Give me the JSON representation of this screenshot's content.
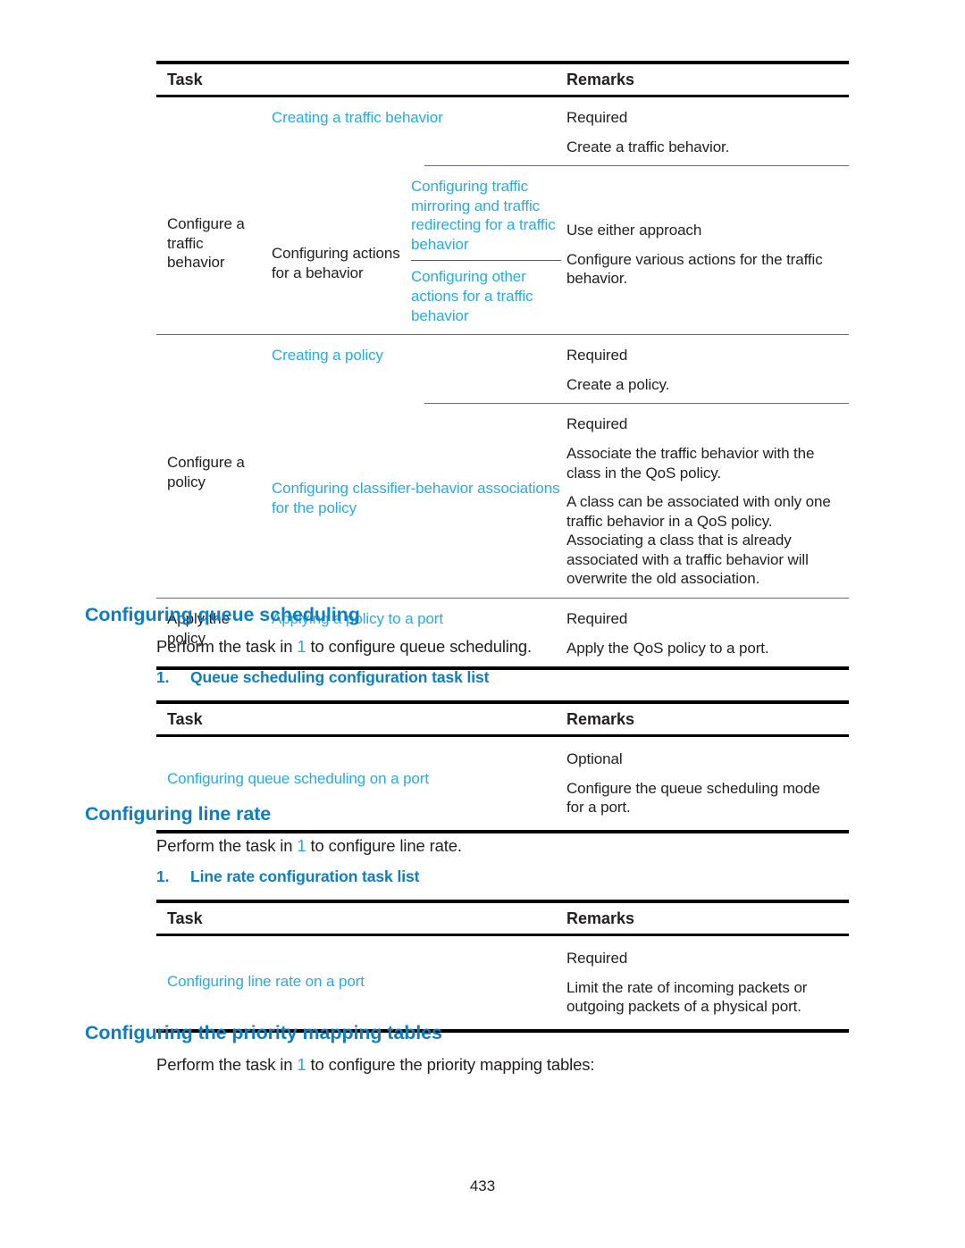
{
  "page": {
    "folio": "433"
  },
  "tables": {
    "main": {
      "headers": {
        "task": "Task",
        "remarks": "Remarks"
      },
      "rows": {
        "behavior_group_label": "Configure a traffic behavior",
        "creating_behavior_link": "Creating a traffic behavior",
        "creating_behavior_remark_1": "Required",
        "creating_behavior_remark_2": "Create a traffic behavior.",
        "configuring_actions_label": "Configuring actions for a behavior",
        "action_link_1": "Configuring traffic mirroring and traffic redirecting for a traffic behavior",
        "action_link_2": "Configuring other actions for a traffic behavior",
        "actions_remark_1": "Use either approach",
        "actions_remark_2": "Configure various actions for the traffic behavior.",
        "policy_group_label": "Configure a policy",
        "creating_policy_link": "Creating a policy",
        "creating_policy_remark_1": "Required",
        "creating_policy_remark_2": "Create a policy.",
        "classifier_link": "Configuring classifier-behavior associations for the policy",
        "classifier_remark_1": "Required",
        "classifier_remark_2": "Associate the traffic behavior with the class in the QoS policy.",
        "classifier_remark_3": "A class can be associated with only one traffic behavior in a QoS policy. Associating a class that is already associated with a traffic behavior will overwrite the old association.",
        "apply_group_label": "Apply the policy",
        "apply_link": "Applying a policy to a port",
        "apply_remark_1": "Required",
        "apply_remark_2": "Apply the QoS policy to a port."
      }
    },
    "queue": {
      "headers": {
        "task": "Task",
        "remarks": "Remarks"
      },
      "row": {
        "link": "Configuring queue scheduling on a port",
        "remark_1": "Optional",
        "remark_2": "Configure the queue scheduling mode for a port."
      }
    },
    "line_rate": {
      "headers": {
        "task": "Task",
        "remarks": "Remarks"
      },
      "row": {
        "link": "Configuring line rate on a port",
        "remark_1": "Required",
        "remark_2": "Limit the rate of incoming packets or outgoing packets of a physical port."
      }
    }
  },
  "sections": {
    "queue_scheduling": {
      "heading": "Configuring queue scheduling",
      "intro_before": "Perform the task in ",
      "intro_link": "1",
      "intro_after": " to configure queue scheduling.",
      "list_number": "1.",
      "list_label": "Queue scheduling configuration task list"
    },
    "line_rate": {
      "heading": "Configuring line rate",
      "intro_before": "Perform the task in ",
      "intro_link": "1",
      "intro_after": " to configure line rate.",
      "list_number": "1.",
      "list_label": "Line rate configuration task list"
    },
    "priority_mapping": {
      "heading": "Configuring the priority mapping tables",
      "intro_before": "Perform the task in ",
      "intro_link": "1",
      "intro_after": " to configure the priority mapping tables:"
    }
  },
  "colors": {
    "link_blue": "#29abe2",
    "heading_blue": "#0e7dc2",
    "text_black": "#231f20"
  }
}
